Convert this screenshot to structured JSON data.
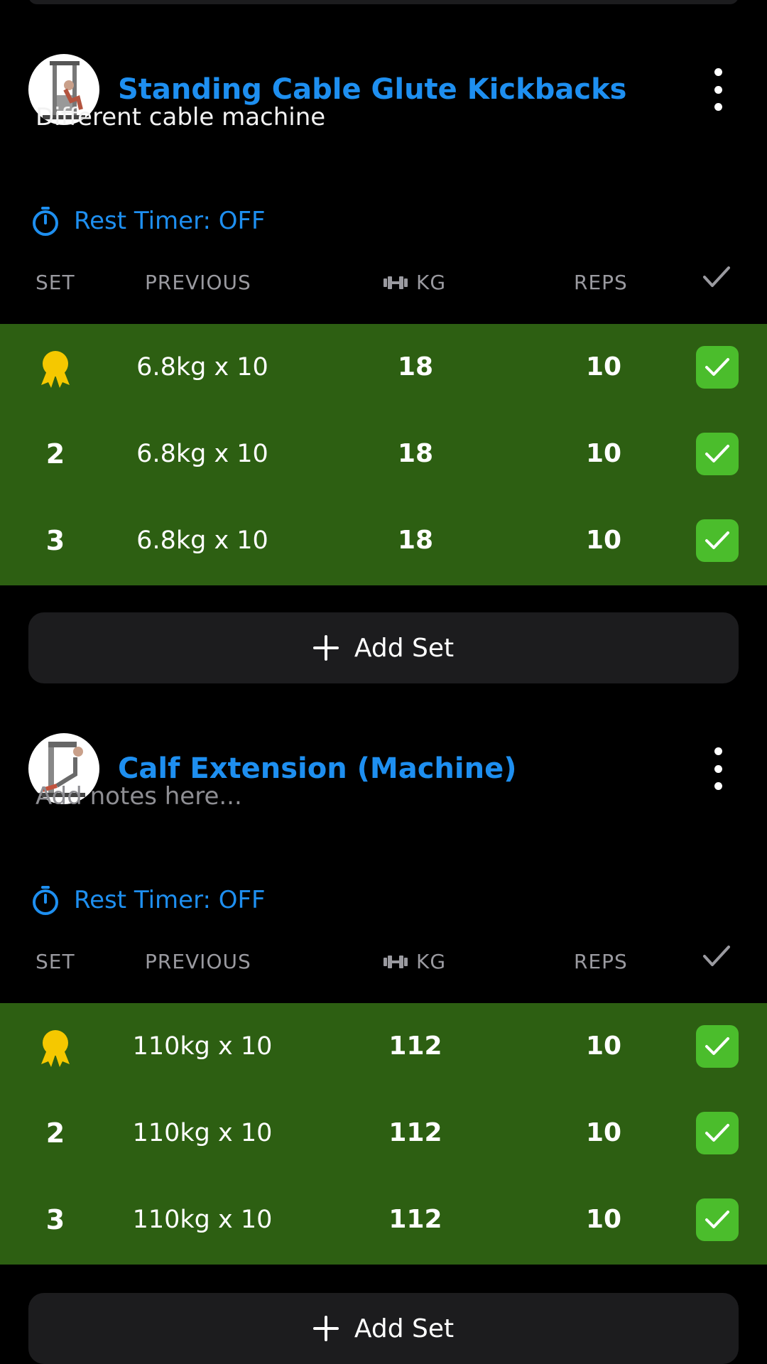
{
  "exercises": [
    {
      "title": "Standing Cable Glute Kickbacks",
      "notes": "Different cable machine",
      "rest_timer": "Rest Timer: OFF",
      "columns": {
        "set": "SET",
        "previous": "PREVIOUS",
        "kg": "KG",
        "reps": "REPS"
      },
      "sets": [
        {
          "set": "",
          "previous": "6.8kg x 10",
          "kg": "18",
          "reps": "10"
        },
        {
          "set": "2",
          "previous": "6.8kg x 10",
          "kg": "18",
          "reps": "10"
        },
        {
          "set": "3",
          "previous": "6.8kg x 10",
          "kg": "18",
          "reps": "10"
        }
      ],
      "add_set": "Add Set"
    },
    {
      "title": "Calf Extension (Machine)",
      "notes_placeholder": "Add notes here...",
      "rest_timer": "Rest Timer: OFF",
      "columns": {
        "set": "SET",
        "previous": "PREVIOUS",
        "kg": "KG",
        "reps": "REPS"
      },
      "sets": [
        {
          "set": "",
          "previous": "110kg x 10",
          "kg": "112",
          "reps": "10"
        },
        {
          "set": "2",
          "previous": "110kg x 10",
          "kg": "112",
          "reps": "10"
        },
        {
          "set": "3",
          "previous": "110kg x 10",
          "kg": "112",
          "reps": "10"
        }
      ],
      "add_set": "Add Set"
    }
  ],
  "colors": {
    "accent": "#1e8ff0",
    "completed_row": "#2d5f12",
    "check": "#4bbd2c",
    "medal": "#f5c800",
    "button_bg": "#1c1c1e"
  },
  "icons": {
    "menu": "kebab-icon",
    "timer": "stopwatch-icon",
    "weight": "dumbbell-icon",
    "done": "check-icon",
    "record": "medal-icon",
    "add": "plus-icon"
  }
}
